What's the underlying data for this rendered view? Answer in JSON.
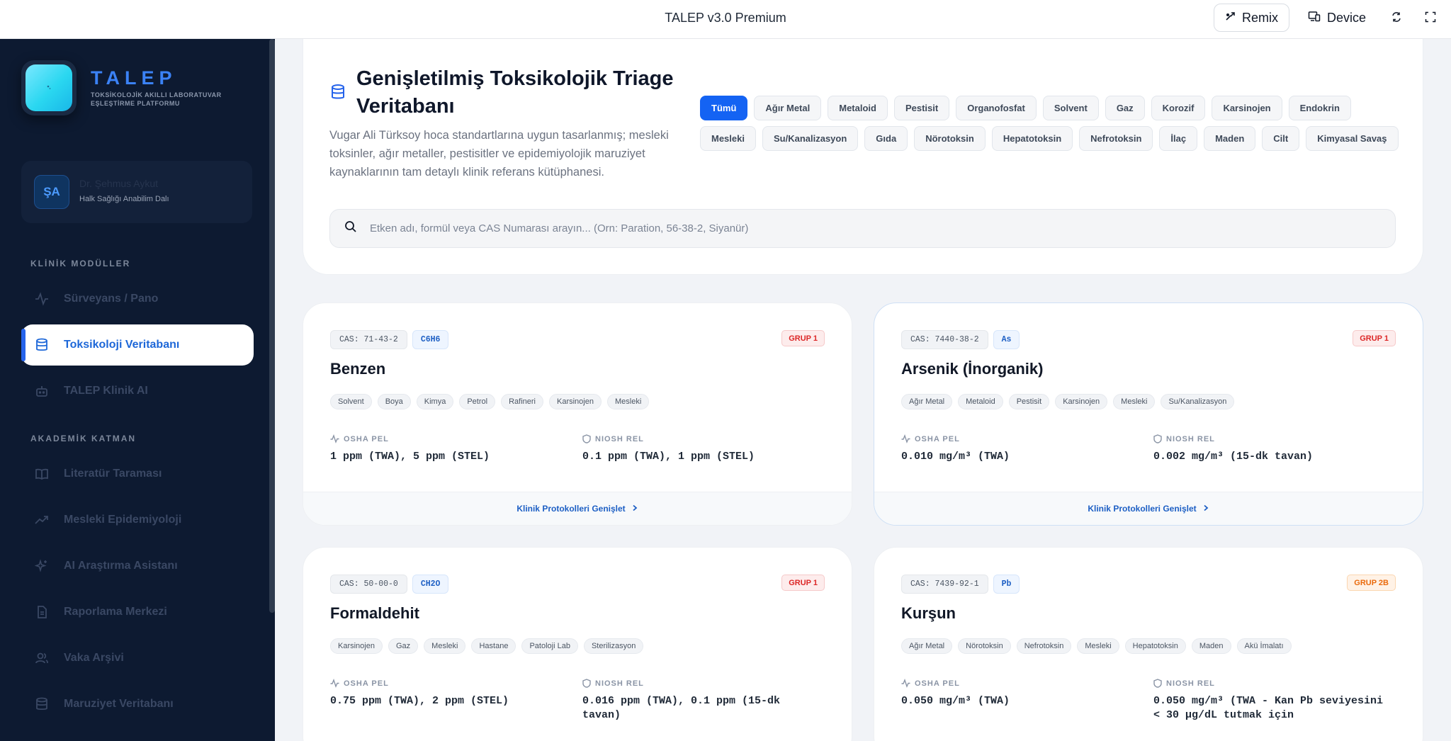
{
  "app": {
    "title": "TALEP v3.0 Premium"
  },
  "toolbar": {
    "remix_label": "Remix",
    "device_label": "Device",
    "remix_icon": "remix-icon",
    "device_icon": "device-icon",
    "refresh_icon": "refresh-icon",
    "fullscreen_icon": "fullscreen-icon"
  },
  "brand": {
    "name": "TALEP",
    "subtitle": "TOKSİKOLOJİK AKILLI LABORATUVAR EŞLEŞTİRME PLATFORMU"
  },
  "user": {
    "initials": "ŞA",
    "name": "Dr. Şehmus Aykut",
    "department": "Halk Sağlığı Anabilim Dalı"
  },
  "nav": {
    "section1": "KLİNİK MODÜLLER",
    "section2": "AKADEMİK KATMAN",
    "items": [
      {
        "label": "Sürveyans / Pano",
        "icon": "activity-icon"
      },
      {
        "label": "Toksikoloji Veritabanı",
        "icon": "database-icon"
      },
      {
        "label": "TALEP Klinik AI",
        "icon": "bot-icon"
      },
      {
        "label": "Literatür Taraması",
        "icon": "book-icon"
      },
      {
        "label": "Mesleki Epidemiyoloji",
        "icon": "trending-up-icon"
      },
      {
        "label": "AI Araştırma Asistanı",
        "icon": "sparkles-icon"
      },
      {
        "label": "Raporlama Merkezi",
        "icon": "file-text-icon"
      },
      {
        "label": "Vaka Arşivi",
        "icon": "users-icon"
      },
      {
        "label": "Maruziyet Veritabanı",
        "icon": "database-icon"
      }
    ]
  },
  "header": {
    "title": "Genişletilmiş Toksikolojik Triage Veritabanı",
    "description": "Vugar Ali Türksoy hoca standartlarına uygun tasarlanmış; mesleki toksinler, ağır metaller, pestisitler ve epidemiyolojik maruziyet kaynaklarının tam detaylı klinik referans kütüphanesi.",
    "filters": [
      "Tümü",
      "Ağır Metal",
      "Metaloid",
      "Pestisit",
      "Organofosfat",
      "Solvent",
      "Gaz",
      "Korozif",
      "Karsinojen",
      "Endokrin",
      "Mesleki",
      "Su/Kanalizasyon",
      "Gıda",
      "Nörotoksin",
      "Hepatotoksin",
      "Nefrotoksin",
      "İlaç",
      "Maden",
      "Cilt",
      "Kimyasal Savaş"
    ],
    "active_filter": "Tümü"
  },
  "search": {
    "placeholder": "Etken adı, formül veya CAS Numarası arayın... (Orn: Paration, 56-38-2, Siyanür)"
  },
  "labels": {
    "osha": "OSHA PEL",
    "niosh": "NIOSH REL",
    "expand": "Klinik Protokolleri Genişlet"
  },
  "cards": [
    {
      "cas": "CAS: 71-43-2",
      "formula": "C6H6",
      "group": "GRUP 1",
      "group_color": "#dc2626",
      "name": "Benzen",
      "tags": [
        "Solvent",
        "Boya",
        "Kimya",
        "Petrol",
        "Rafineri",
        "Karsinojen",
        "Mesleki"
      ],
      "osha": "1 ppm (TWA), 5 ppm (STEL)",
      "niosh": "0.1 ppm (TWA), 1 ppm (STEL)"
    },
    {
      "cas": "CAS: 7440-38-2",
      "formula": "As",
      "group": "GRUP 1",
      "group_color": "#dc2626",
      "name": "Arsenik (İnorganik)",
      "tags": [
        "Ağır Metal",
        "Metaloid",
        "Pestisit",
        "Karsinojen",
        "Mesleki",
        "Su/Kanalizasyon"
      ],
      "osha": "0.010 mg/m³ (TWA)",
      "niosh": "0.002 mg/m³ (15-dk tavan)"
    },
    {
      "cas": "CAS: 50-00-0",
      "formula": "CH2O",
      "group": "GRUP 1",
      "group_color": "#dc2626",
      "name": "Formaldehit",
      "tags": [
        "Karsinojen",
        "Gaz",
        "Mesleki",
        "Hastane",
        "Patoloji Lab",
        "Sterilizasyon"
      ],
      "osha": "0.75 ppm (TWA), 2 ppm (STEL)",
      "niosh": "0.016 ppm (TWA), 0.1 ppm (15-dk tavan)"
    },
    {
      "cas": "CAS: 7439-92-1",
      "formula": "Pb",
      "group": "GRUP 2B",
      "group_color": "#ea6a0c",
      "name": "Kurşun",
      "tags": [
        "Ağır Metal",
        "Nörotoksin",
        "Nefrotoksin",
        "Mesleki",
        "Hepatotoksin",
        "Maden",
        "Akü İmalatı"
      ],
      "osha": "0.050 mg/m³ (TWA)",
      "niosh": "0.050 mg/m³ (TWA - Kan Pb seviyesini < 30 µg/dL tutmak için"
    }
  ]
}
